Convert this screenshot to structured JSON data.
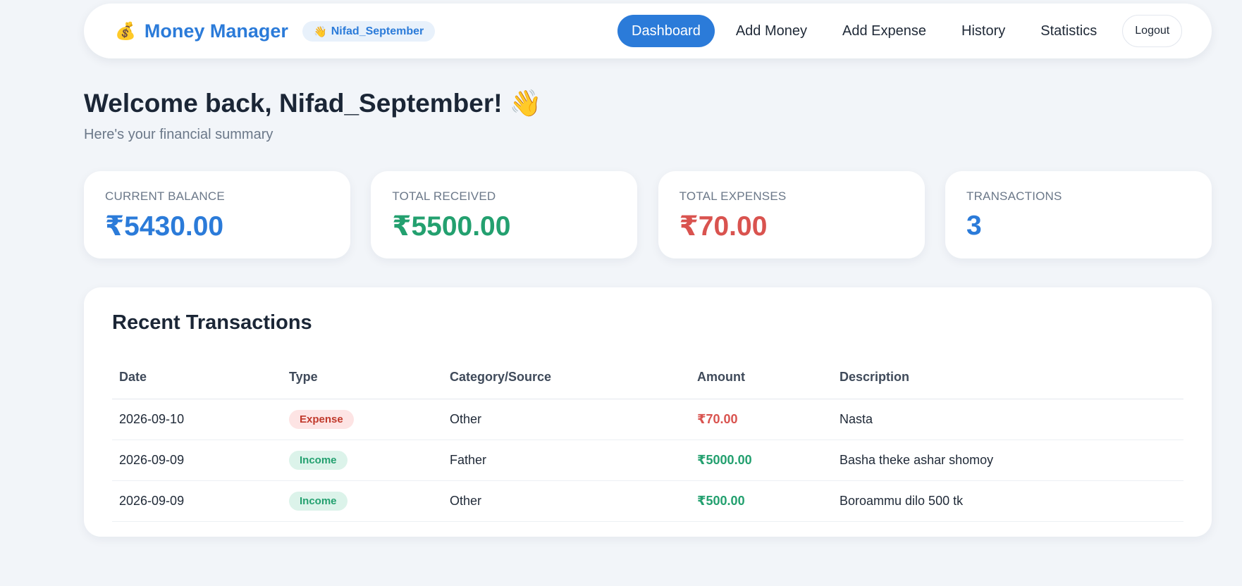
{
  "header": {
    "brand_icon": "💰",
    "brand_title": "Money Manager",
    "user_wave": "👋",
    "user_name": "Nifad_September",
    "nav": [
      {
        "label": "Dashboard",
        "active": true
      },
      {
        "label": "Add Money",
        "active": false
      },
      {
        "label": "Add Expense",
        "active": false
      },
      {
        "label": "History",
        "active": false
      },
      {
        "label": "Statistics",
        "active": false
      }
    ],
    "logout_label": "Logout"
  },
  "welcome": {
    "title": "Welcome back, Nifad_September! 👋",
    "subtitle": "Here's your financial summary"
  },
  "cards": [
    {
      "label": "Current Balance",
      "value": "₹5430.00",
      "color": "#2b7bd9"
    },
    {
      "label": "Total Received",
      "value": "₹5500.00",
      "color": "#23a06f"
    },
    {
      "label": "Total Expenses",
      "value": "₹70.00",
      "color": "#d9534f"
    },
    {
      "label": "Transactions",
      "value": "3",
      "color": "#2b7bd9"
    }
  ],
  "transactions": {
    "title": "Recent Transactions",
    "columns": [
      "Date",
      "Type",
      "Category/Source",
      "Amount",
      "Description"
    ],
    "rows": [
      {
        "date": "2026-09-10",
        "type": "Expense",
        "category": "Other",
        "amount": "₹70.00",
        "description": "Nasta"
      },
      {
        "date": "2026-09-09",
        "type": "Income",
        "category": "Father",
        "amount": "₹5000.00",
        "description": "Basha theke ashar shomoy"
      },
      {
        "date": "2026-09-09",
        "type": "Income",
        "category": "Other",
        "amount": "₹500.00",
        "description": "Boroammu dilo 500 tk"
      }
    ]
  },
  "colors": {
    "accent": "#2b7bd9",
    "income": "#23a06f",
    "income_bg": "#dcf3ea",
    "expense": "#d9534f",
    "expense_badge_text": "#c0392b",
    "expense_bg": "#fde4e4"
  }
}
